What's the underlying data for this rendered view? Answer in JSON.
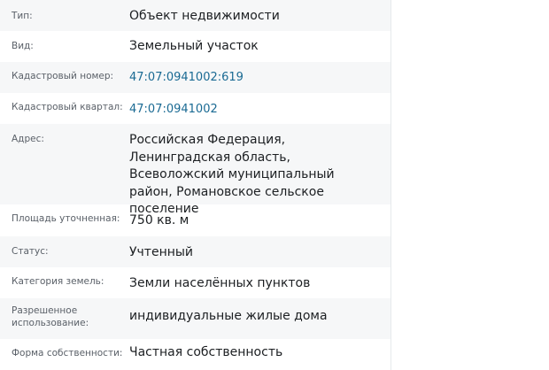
{
  "properties": [
    {
      "label": "Тип:",
      "value": "Объект недвижимости"
    },
    {
      "label": "Вид:",
      "value": "Земельный участок"
    },
    {
      "label": "Кадастровый номер:",
      "value": "47:07:0941002:619"
    },
    {
      "label": "Кадастровый квартал:",
      "value": "47:07:0941002"
    },
    {
      "label": "Адрес:",
      "value": "Российская Федерация, Ленинградская область, Всеволожский муниципальный район, Романовское сельское поселение"
    },
    {
      "label": "Площадь уточненная:",
      "value": "750 кв. м"
    },
    {
      "label": "Статус:",
      "value": "Учтенный"
    },
    {
      "label": "Категория земель:",
      "value": "Земли населённых пунктов"
    },
    {
      "label": "Разрешенное использование:",
      "value": "индивидуальные жилые дома"
    },
    {
      "label": "Форма собственности:",
      "value": "Частная собственность"
    }
  ],
  "colors": {
    "row_alt_background": "#f6f7f8",
    "label_text": "#5a6068",
    "value_text": "#1c1f22",
    "link_text": "#1a6a93"
  }
}
